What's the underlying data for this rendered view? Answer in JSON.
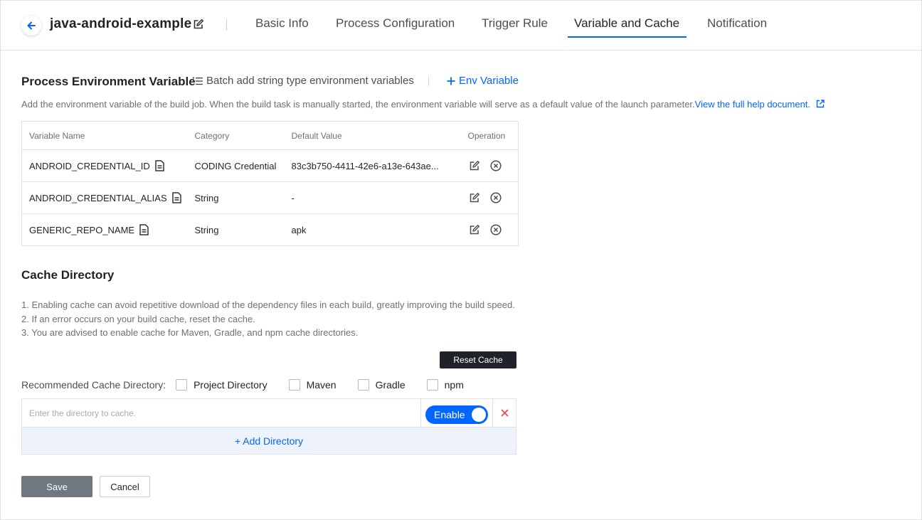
{
  "header": {
    "job_name": "java-android-example",
    "tabs": [
      {
        "label": "Basic Info"
      },
      {
        "label": "Process Configuration"
      },
      {
        "label": "Trigger Rule"
      },
      {
        "label": "Variable and Cache"
      },
      {
        "label": "Notification"
      }
    ],
    "active_tab": "Variable and Cache"
  },
  "env": {
    "title": "Process Environment Variable",
    "batch_label": "Batch add string type environment variables",
    "add_label": "Env Variable",
    "description": "Add the environment variable of the build job. When the build task is manually started, the environment variable will serve as a default value of the launch parameter.",
    "help_link": "View the full help document.",
    "columns": [
      "Variable Name",
      "Category",
      "Default Value",
      "Operation"
    ],
    "rows": [
      {
        "name": "ANDROID_CREDENTIAL_ID",
        "category": "CODING Credential",
        "value": "83c3b750-4411-42e6-a13e-643ae..."
      },
      {
        "name": "ANDROID_CREDENTIAL_ALIAS",
        "category": "String",
        "value": "-"
      },
      {
        "name": "GENERIC_REPO_NAME",
        "category": "String",
        "value": "apk"
      }
    ]
  },
  "cache": {
    "title": "Cache Directory",
    "notes": [
      "1. Enabling cache can avoid repetitive download of the dependency files in each build, greatly improving the build speed.",
      "2. If an error occurs on your build cache, reset the cache.",
      "3. You are advised to enable cache for Maven, Gradle, and npm cache directories."
    ],
    "reset_label": "Reset Cache",
    "recommended_label": "Recommended Cache Directory:",
    "options": [
      {
        "label": "Project Directory",
        "checked": false
      },
      {
        "label": "Maven",
        "checked": false
      },
      {
        "label": "Gradle",
        "checked": false
      },
      {
        "label": "npm",
        "checked": false
      }
    ],
    "dir_placeholder": "Enter the directory to cache.",
    "toggle_label": "Enable",
    "toggle_on": true,
    "add_dir_label": "+ Add Directory"
  },
  "actions": {
    "save_label": "Save",
    "cancel_label": "Cancel"
  },
  "colors": {
    "accent": "#0066ff",
    "remove": "#e5484d"
  }
}
